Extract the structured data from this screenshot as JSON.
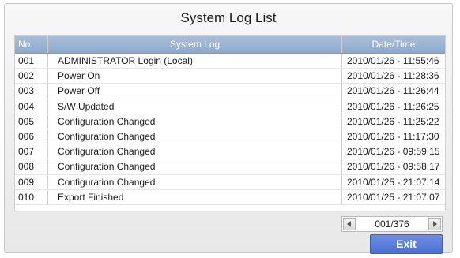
{
  "title": "System Log List",
  "table": {
    "headers": {
      "no": "No.",
      "log": "System Log",
      "date": "Date/Time"
    },
    "rows": [
      {
        "no": "001",
        "log": "ADMINISTRATOR  Login (Local)",
        "date": "2010/01/26 - 11:55:46"
      },
      {
        "no": "002",
        "log": "Power On",
        "date": "2010/01/26 - 11:28:36"
      },
      {
        "no": "003",
        "log": "Power Off",
        "date": "2010/01/26 - 11:26:44"
      },
      {
        "no": "004",
        "log": "S/W Updated",
        "date": "2010/01/26 - 11:26:25"
      },
      {
        "no": "005",
        "log": "Configuration Changed",
        "date": "2010/01/26 - 11:25:22"
      },
      {
        "no": "006",
        "log": "Configuration Changed",
        "date": "2010/01/26 - 11:17:30"
      },
      {
        "no": "007",
        "log": "Configuration Changed",
        "date": "2010/01/26 - 09:59:15"
      },
      {
        "no": "008",
        "log": "Configuration Changed",
        "date": "2010/01/26 - 09:58:17"
      },
      {
        "no": "009",
        "log": "Configuration Changed",
        "date": "2010/01/25 - 21:07:14"
      },
      {
        "no": "010",
        "log": "Export Finished",
        "date": "2010/01/25 - 21:07:07"
      }
    ]
  },
  "pager": {
    "text": "001/376",
    "prev_icon": "left-arrow-icon",
    "next_icon": "right-arrow-icon"
  },
  "buttons": {
    "exit": "Exit"
  },
  "colors": {
    "header_bg": "#8faacd",
    "exit_bg": "#4c6fd0"
  }
}
